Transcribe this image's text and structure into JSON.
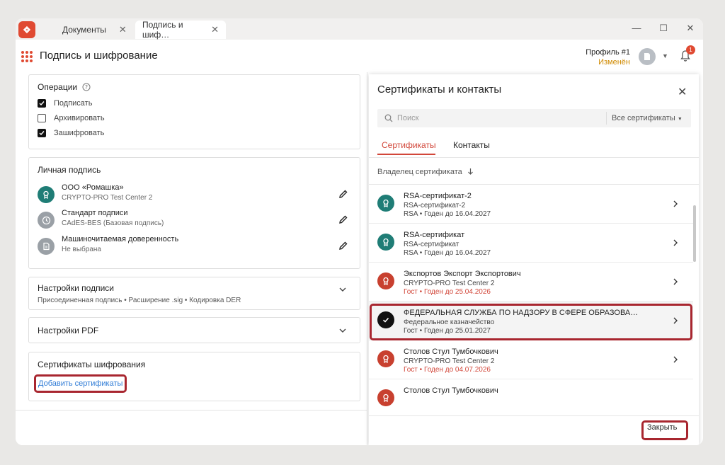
{
  "tabs": [
    {
      "label": "Документы"
    },
    {
      "label": "Подпись и шиф…"
    }
  ],
  "header": {
    "title": "Подпись и шифрование",
    "profile_name": "Профиль #1",
    "profile_status": "Изменён",
    "notifications": "1"
  },
  "operations": {
    "title": "Операции",
    "items": [
      {
        "label": "Подписать",
        "checked": true
      },
      {
        "label": "Архивировать",
        "checked": false
      },
      {
        "label": "Зашифровать",
        "checked": true
      }
    ]
  },
  "personal_signature": {
    "title": "Личная подпись",
    "items": [
      {
        "title": "ООО «Ромашка»",
        "subtitle": "CRYPTO-PRO Test Center 2"
      },
      {
        "title": "Стандарт подписи",
        "subtitle": "CAdES-BES (Базовая подпись)"
      },
      {
        "title": "Машиночитаемая доверенность",
        "subtitle": "Не выбрана"
      }
    ]
  },
  "signature_settings": {
    "title": "Настройки подписи",
    "summary": "Присоединенная подпись • Расширение .sig • Кодировка DER"
  },
  "pdf_settings": {
    "title": "Настройки PDF"
  },
  "encryption_certs": {
    "title": "Сертификаты шифрования",
    "add_link": "Добавить сертификаты"
  },
  "panel": {
    "title": "Сертификаты и контакты",
    "search_placeholder": "Поиск",
    "filter": "Все сертификаты",
    "tabs": [
      {
        "label": "Сертификаты"
      },
      {
        "label": "Контакты"
      }
    ],
    "column_header": "Владелец сертификата",
    "certs": [
      {
        "name": "RSA-сертификат-2",
        "issuer": "RSA-сертификат-2",
        "info": "RSA • Годен до 16.04.2027",
        "color": "#1f7d76",
        "expired": false,
        "selected": false
      },
      {
        "name": "RSA-сертификат",
        "issuer": "RSA-сертификат",
        "info": "RSA • Годен до 16.04.2027",
        "color": "#1f7d76",
        "expired": false,
        "selected": false
      },
      {
        "name": "Экспортов Экспорт Экспортович",
        "issuer": "CRYPTO-PRO Test Center 2",
        "info": "Гост • Годен до 25.04.2026",
        "color": "#c8402f",
        "expired": true,
        "selected": false
      },
      {
        "name": "ФЕДЕРАЛЬНАЯ СЛУЖБА ПО НАДЗОРУ В СФЕРЕ ОБРАЗОВА…",
        "issuer": "Федеральное казначейство",
        "info": "Гост • Годен до 25.01.2027",
        "color": "#111111",
        "expired": false,
        "selected": true
      },
      {
        "name": "Столов Стул Тумбочкович",
        "issuer": "CRYPTO-PRO Test Center 2",
        "info": "Гост • Годен до 04.07.2026",
        "color": "#c8402f",
        "expired": true,
        "selected": false
      },
      {
        "name": "Столов Стул Тумбочкович",
        "issuer": "",
        "info": "",
        "color": "#c8402f",
        "expired": true,
        "selected": false
      }
    ],
    "close_button": "Закрыть"
  }
}
